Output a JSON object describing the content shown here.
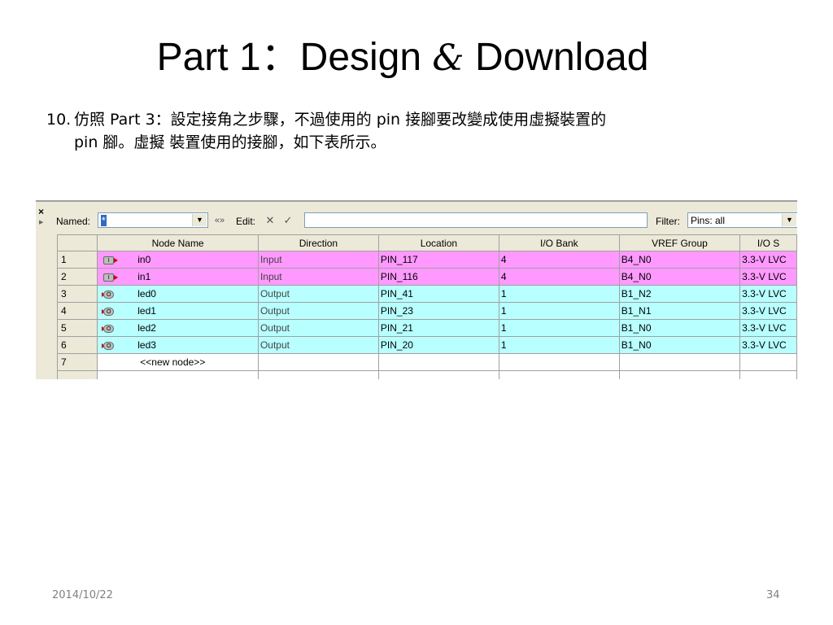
{
  "slide": {
    "title_part": "Part 1：Design",
    "title_amp": "&",
    "title_end": "Download",
    "step_number": "10.",
    "step_line1": "仿照 Part 3：設定接角之步驟，不過使用的 pin 接腳要改變成使用虛擬裝置的",
    "step_line2": "pin 腳。虛擬 裝置使用的接腳，如下表所示。",
    "footer_date": "2014/10/22",
    "footer_page": "34"
  },
  "pin_planner": {
    "close_glyph": "×",
    "named_label": "Named:",
    "named_value": "*",
    "expand_glyph": "«»",
    "edit_label": "Edit:",
    "cancel_glyph": "✕",
    "accept_glyph": "✓",
    "filter_label": "Filter:",
    "filter_value": "Pins: all",
    "dropdown_glyph": "▼",
    "columns": [
      "Node Name",
      "Direction",
      "Location",
      "I/O Bank",
      "VREF Group",
      "I/O S"
    ],
    "rows": [
      {
        "num": "1",
        "name": "in0",
        "direction": "Input",
        "location": "PIN_117",
        "bank": "4",
        "vref": "B4_N0",
        "std": "3.3-V LVC",
        "pin_glyph": "I"
      },
      {
        "num": "2",
        "name": "in1",
        "direction": "Input",
        "location": "PIN_116",
        "bank": "4",
        "vref": "B4_N0",
        "std": "3.3-V LVC",
        "pin_glyph": "I"
      },
      {
        "num": "3",
        "name": "led0",
        "direction": "Output",
        "location": "PIN_41",
        "bank": "1",
        "vref": "B1_N2",
        "std": "3.3-V LVC",
        "pin_glyph": "O"
      },
      {
        "num": "4",
        "name": "led1",
        "direction": "Output",
        "location": "PIN_23",
        "bank": "1",
        "vref": "B1_N1",
        "std": "3.3-V LVC",
        "pin_glyph": "O"
      },
      {
        "num": "5",
        "name": "led2",
        "direction": "Output",
        "location": "PIN_21",
        "bank": "1",
        "vref": "B1_N0",
        "std": "3.3-V LVC",
        "pin_glyph": "O"
      },
      {
        "num": "6",
        "name": "led3",
        "direction": "Output",
        "location": "PIN_20",
        "bank": "1",
        "vref": "B1_N0",
        "std": "3.3-V LVC",
        "pin_glyph": "O"
      }
    ],
    "new_row": {
      "num": "7",
      "name": "<<new node>>"
    }
  },
  "colors": {
    "input_row": "#ff99ff",
    "output_row": "#b8ffff"
  }
}
